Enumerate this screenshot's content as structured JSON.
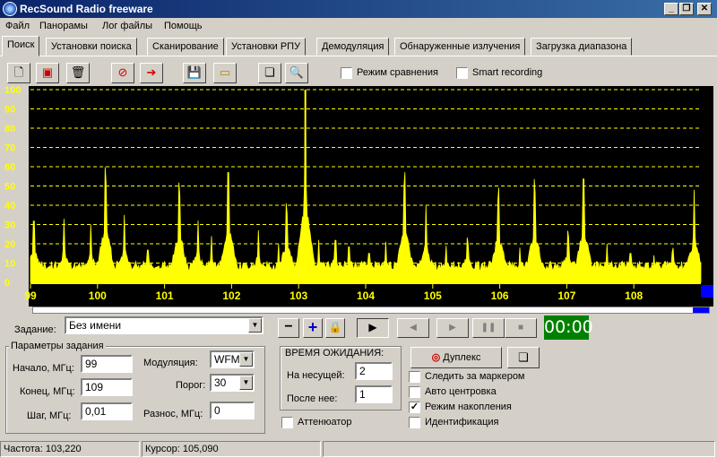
{
  "window": {
    "title": "RecSound Radio freeware",
    "min": "_",
    "restore": "❐",
    "close": "✕"
  },
  "menu": [
    "Файл",
    "Панорамы",
    "Лог файлы",
    "Помощь"
  ],
  "tabs": [
    "Поиск",
    "Установки поиска",
    "Сканирование",
    "Установки РПУ",
    "Демодуляция",
    "Обнаруженные излучения",
    "Загрузка диапазона"
  ],
  "toolbar": {
    "icons": [
      "new-file-icon",
      "save-record-icon",
      "trash-icon",
      "stop-record-icon",
      "import-icon",
      "save-icon",
      "open-folder-icon",
      "copy-icon",
      "zoom-icon"
    ],
    "compare_mode": "Режим сравнения",
    "smart_recording": "Smart recording"
  },
  "chart_data": {
    "type": "area",
    "title": "",
    "xlabel": "",
    "ylabel": "",
    "xlim": [
      99,
      109
    ],
    "ylim": [
      0,
      100
    ],
    "x_ticks": [
      "99",
      "100",
      "101",
      "102",
      "103",
      "104",
      "105",
      "106",
      "107",
      "108"
    ],
    "y_ticks": [
      "0",
      "10",
      "20",
      "30",
      "40",
      "50",
      "60",
      "70",
      "80",
      "90",
      "100"
    ],
    "grid": true,
    "background": "#000000",
    "fill_color": "#ffff00",
    "marker_color": "#ffff00",
    "marker_x": 103.1,
    "baseline": 6,
    "peaks": [
      {
        "x": 99.05,
        "y": 38
      },
      {
        "x": 99.5,
        "y": 33
      },
      {
        "x": 99.9,
        "y": 30
      },
      {
        "x": 100.05,
        "y": 22
      },
      {
        "x": 100.12,
        "y": 67
      },
      {
        "x": 100.4,
        "y": 35
      },
      {
        "x": 100.75,
        "y": 20
      },
      {
        "x": 101.22,
        "y": 58
      },
      {
        "x": 101.5,
        "y": 32
      },
      {
        "x": 101.7,
        "y": 24
      },
      {
        "x": 101.95,
        "y": 68
      },
      {
        "x": 102.4,
        "y": 27
      },
      {
        "x": 102.7,
        "y": 20
      },
      {
        "x": 102.82,
        "y": 46
      },
      {
        "x": 103.1,
        "y": 100
      },
      {
        "x": 103.3,
        "y": 22
      },
      {
        "x": 103.55,
        "y": 26
      },
      {
        "x": 103.75,
        "y": 22
      },
      {
        "x": 104.05,
        "y": 18
      },
      {
        "x": 104.3,
        "y": 21
      },
      {
        "x": 104.58,
        "y": 64
      },
      {
        "x": 104.9,
        "y": 40
      },
      {
        "x": 105.2,
        "y": 19
      },
      {
        "x": 105.52,
        "y": 26
      },
      {
        "x": 105.98,
        "y": 55
      },
      {
        "x": 106.3,
        "y": 18
      },
      {
        "x": 106.52,
        "y": 60
      },
      {
        "x": 107.02,
        "y": 30
      },
      {
        "x": 107.25,
        "y": 64
      },
      {
        "x": 107.6,
        "y": 20
      },
      {
        "x": 107.95,
        "y": 18
      },
      {
        "x": 108.3,
        "y": 14
      },
      {
        "x": 108.58,
        "y": 20
      },
      {
        "x": 108.9,
        "y": 48
      }
    ]
  },
  "task": {
    "label": "Задание:",
    "value": "Без имени",
    "minus": "−",
    "plus": "+"
  },
  "timer": "00:00",
  "params": {
    "group_title": "Параметры задания",
    "start_label": "Начало, МГц:",
    "start_value": "99",
    "end_label": "Конец, МГц:",
    "end_value": "109",
    "step_label": "Шаг, МГц:",
    "step_value": "0,01",
    "modulation_label": "Модуляция:",
    "modulation_value": "WFM",
    "threshold_label": "Порог:",
    "threshold_value": "30",
    "spacing_label": "Разнос, МГц:",
    "spacing_value": "0"
  },
  "wait": {
    "title": "ВРЕМЯ ОЖИДАНИЯ:",
    "carrier_label": "На несущей:",
    "carrier_value": "2",
    "after_label": "После нее:",
    "after_value": "1"
  },
  "attenuator": "Аттенюатор",
  "duplex": "Дуплекс",
  "options": [
    {
      "label": "Следить за маркером",
      "checked": false
    },
    {
      "label": "Авто центровка",
      "checked": false
    },
    {
      "label": "Режим накопления",
      "checked": true
    },
    {
      "label": "Идентификация",
      "checked": false
    }
  ],
  "status": {
    "freq": "Частота: 103,220",
    "cursor": "Курсор: 105,090"
  }
}
